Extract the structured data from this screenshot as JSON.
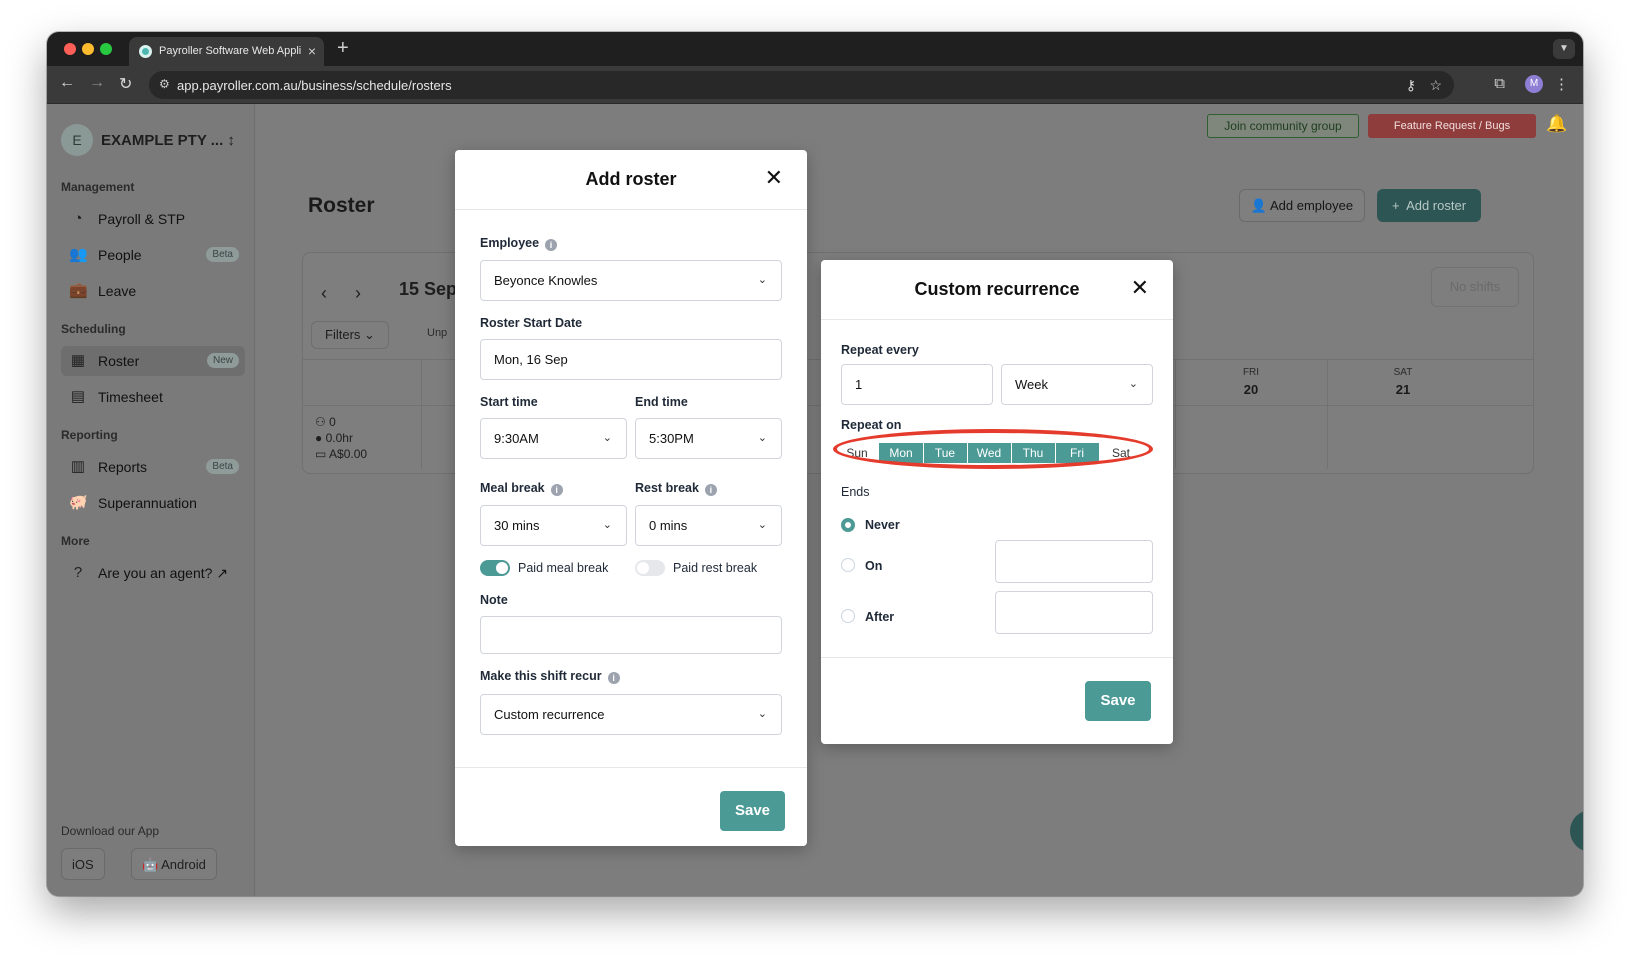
{
  "browser": {
    "tab_title": "Payroller Software Web Appli",
    "url": "app.payroller.com.au/business/schedule/rosters",
    "profile_initial": "M"
  },
  "sidebar": {
    "company_initial": "E",
    "company_name": "EXAMPLE PTY ... ↕",
    "sections": {
      "management": "Management",
      "scheduling": "Scheduling",
      "reporting": "Reporting",
      "more": "More"
    },
    "items": {
      "payroll": "Payroll & STP",
      "people": "People",
      "people_badge": "Beta",
      "leave": "Leave",
      "roster": "Roster",
      "roster_badge": "New",
      "timesheet": "Timesheet",
      "reports": "Reports",
      "reports_badge": "Beta",
      "super": "Superannuation",
      "agent": "Are you an agent?"
    },
    "download_title": "Download our App",
    "ios": "iOS",
    "android": "Android"
  },
  "header": {
    "community": "Join community group",
    "feature": "Feature Request / Bugs"
  },
  "page": {
    "title": "Roster",
    "add_employee": "Add employee",
    "add_roster": "Add roster",
    "date_range": "15 Sep",
    "filters": "Filters",
    "unp": "Unp",
    "no_shifts": "No shifts",
    "days": [
      {
        "name": "FRI",
        "num": "20"
      },
      {
        "name": "SAT",
        "num": "21"
      }
    ],
    "stats": {
      "count": "0",
      "hours": "0.0hr",
      "cost": "A$0.00"
    }
  },
  "add_roster_modal": {
    "title": "Add roster",
    "employee_label": "Employee",
    "employee_value": "Beyonce Knowles",
    "start_date_label": "Roster Start Date",
    "start_date_value": "Mon, 16 Sep",
    "start_time_label": "Start time",
    "start_time_value": "9:30AM",
    "end_time_label": "End time",
    "end_time_value": "5:30PM",
    "meal_break_label": "Meal break",
    "meal_break_value": "30 mins",
    "rest_break_label": "Rest break",
    "rest_break_value": "0 mins",
    "paid_meal_label": "Paid meal break",
    "paid_rest_label": "Paid rest break",
    "note_label": "Note",
    "recur_label": "Make this shift recur",
    "recur_value": "Custom recurrence",
    "save": "Save"
  },
  "custom_recurrence_modal": {
    "title": "Custom recurrence",
    "repeat_every_label": "Repeat every",
    "repeat_every_value": "1",
    "repeat_unit": "Week",
    "repeat_on_label": "Repeat on",
    "weekdays": [
      "Sun",
      "Mon",
      "Tue",
      "Wed",
      "Thu",
      "Fri",
      "Sat"
    ],
    "ends_label": "Ends",
    "never": "Never",
    "on": "On",
    "after": "After",
    "save": "Save"
  },
  "colors": {
    "accent": "#4b9a96",
    "annotation": "#e53b2c"
  }
}
